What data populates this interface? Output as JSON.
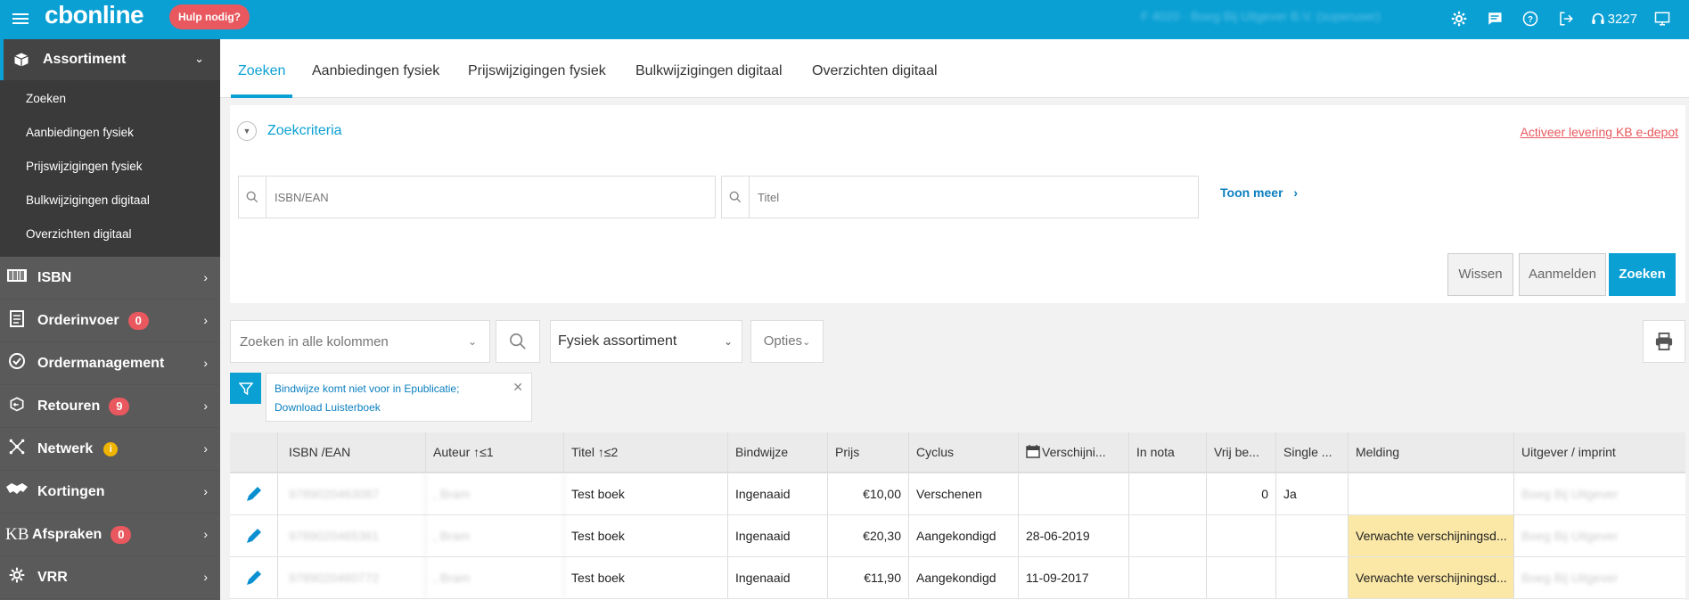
{
  "header": {
    "logo": "cbonline",
    "help_label": "Hulp nodig?",
    "user_info": "F 4020 - Boeg Bij Uitgever B.V. (superuser)",
    "ticket_count": "3227",
    "icons": [
      "gear-icon",
      "chat-icon",
      "help-icon",
      "logout-icon",
      "headset-icon",
      "monitor-icon"
    ]
  },
  "sidebar": {
    "active": {
      "label": "Assortiment",
      "icon": "box-icon"
    },
    "sub_items": [
      "Zoeken",
      "Aanbiedingen fysiek",
      "Prijswijzigingen fysiek",
      "Bulkwijzigingen digitaal",
      "Overzichten digitaal"
    ],
    "items": [
      {
        "label": "ISBN",
        "icon": "barcode-icon",
        "badge": ""
      },
      {
        "label": "Orderinvoer",
        "icon": "clipboard-icon",
        "badge": "0"
      },
      {
        "label": "Ordermanagement",
        "icon": "check-circle-icon",
        "badge": ""
      },
      {
        "label": "Retouren",
        "icon": "return-box-icon",
        "badge": "9"
      },
      {
        "label": "Netwerk",
        "icon": "network-icon",
        "badge": "i"
      },
      {
        "label": "Kortingen",
        "icon": "handshake-icon",
        "badge": ""
      },
      {
        "label": "Afspraken",
        "icon": "kb-icon",
        "badge": "0"
      },
      {
        "label": "VRR",
        "icon": "gear-small-icon",
        "badge": ""
      }
    ]
  },
  "tabs": [
    "Zoeken",
    "Aanbiedingen fysiek",
    "Prijswijzigingen fysiek",
    "Bulkwijzigingen digitaal",
    "Overzichten digitaal"
  ],
  "search": {
    "criteria_title": "Zoekcriteria",
    "activeer_link": "Activeer levering KB e-depot",
    "isbn_placeholder": "ISBN/EAN",
    "titel_placeholder": "Titel",
    "toon_meer": "Toon meer",
    "btn_wissen": "Wissen",
    "btn_aanmelden": "Aanmelden",
    "btn_zoeken": "Zoeken"
  },
  "toolbar": {
    "search_placeholder": "Zoeken in alle kolommen",
    "assortiment_select": "Fysiek assortiment",
    "opties": "Opties"
  },
  "filter": {
    "text": "Bindwijze komt niet voor in Epublicatie; Download Luisterboek"
  },
  "grid": {
    "headers": [
      "",
      "ISBN /EAN",
      "Auteur ↑≤1",
      "Titel ↑≤2",
      "Bindwijze",
      "Prijs",
      "Cyclus",
      "Verschijni...",
      "In nota",
      "Vrij be...",
      "Single ...",
      "Melding",
      "Uitgever / imprint"
    ],
    "rows": [
      {
        "isbn": "9789020463087",
        "auteur": ", Bram",
        "titel": "Test boek",
        "bindwijze": "Ingenaaid",
        "prijs": "€10,00",
        "cyclus": "Verschenen",
        "verschijning": "",
        "in_nota": "",
        "vrij": "0",
        "single": "Ja",
        "melding": "",
        "uitgever": "Boeg Bij Uitgever"
      },
      {
        "isbn": "9789020465361",
        "auteur": ", Bram",
        "titel": "Test boek",
        "bindwijze": "Ingenaaid",
        "prijs": "€20,30",
        "cyclus": "Aangekondigd",
        "verschijning": "28-06-2019",
        "in_nota": "",
        "vrij": "",
        "single": "",
        "melding": "Verwachte verschijningsd...",
        "uitgever": "Boeg Bij Uitgever"
      },
      {
        "isbn": "9789020460772",
        "auteur": ", Bram",
        "titel": "Test boek",
        "bindwijze": "Ingenaaid",
        "prijs": "€11,90",
        "cyclus": "Aangekondigd",
        "verschijning": "11-09-2017",
        "in_nota": "",
        "vrij": "",
        "single": "",
        "melding": "Verwachte verschijningsd...",
        "uitgever": "Boeg Bij Uitgever"
      }
    ]
  },
  "colors": {
    "accent": "#0aa0d4",
    "badge_red": "#e8585e",
    "melding_yellow": "#fbe8a6",
    "sidebar_bg": "#5a5a5a"
  }
}
